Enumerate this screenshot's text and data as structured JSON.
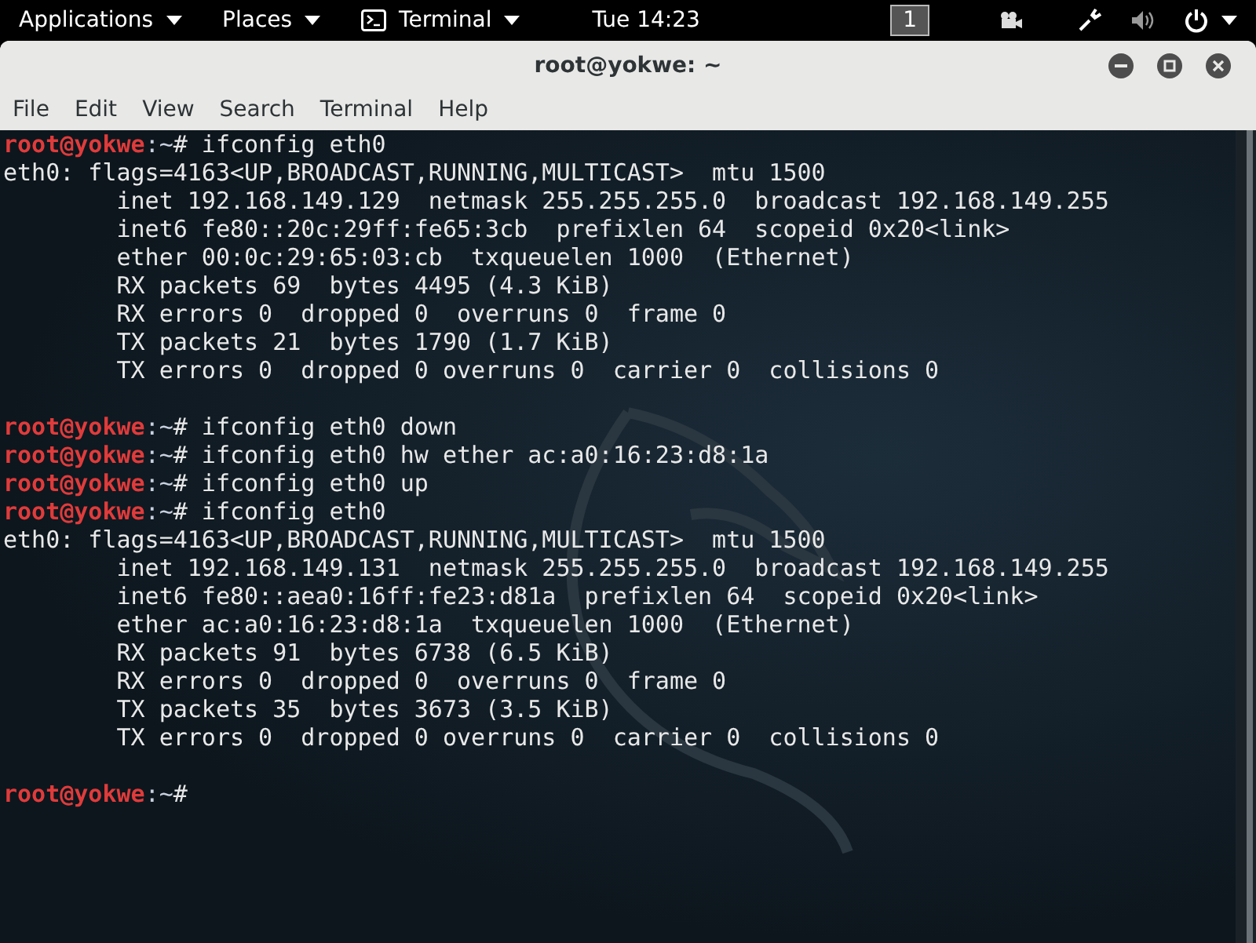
{
  "top_bar": {
    "menus": [
      {
        "label": "Applications",
        "kind": "menu"
      },
      {
        "label": "Places",
        "kind": "menu"
      },
      {
        "label": "Terminal",
        "kind": "app"
      }
    ],
    "clock": "Tue 14:23",
    "workspace": "1"
  },
  "window": {
    "title": "root@yokwe: ~"
  },
  "menu_bar": [
    "File",
    "Edit",
    "View",
    "Search",
    "Terminal",
    "Help"
  ],
  "terminal": {
    "lines": [
      {
        "kind": "prompt",
        "user": "root@yokwe",
        "path": ":~",
        "symbol": "#",
        "command": "ifconfig eth0"
      },
      {
        "kind": "output",
        "text": "eth0: flags=4163<UP,BROADCAST,RUNNING,MULTICAST>  mtu 1500"
      },
      {
        "kind": "output",
        "text": "        inet 192.168.149.129  netmask 255.255.255.0  broadcast 192.168.149.255"
      },
      {
        "kind": "output",
        "text": "        inet6 fe80::20c:29ff:fe65:3cb  prefixlen 64  scopeid 0x20<link>"
      },
      {
        "kind": "output",
        "text": "        ether 00:0c:29:65:03:cb  txqueuelen 1000  (Ethernet)"
      },
      {
        "kind": "output",
        "text": "        RX packets 69  bytes 4495 (4.3 KiB)"
      },
      {
        "kind": "output",
        "text": "        RX errors 0  dropped 0  overruns 0  frame 0"
      },
      {
        "kind": "output",
        "text": "        TX packets 21  bytes 1790 (1.7 KiB)"
      },
      {
        "kind": "output",
        "text": "        TX errors 0  dropped 0 overruns 0  carrier 0  collisions 0"
      },
      {
        "kind": "blank"
      },
      {
        "kind": "prompt",
        "user": "root@yokwe",
        "path": ":~",
        "symbol": "#",
        "command": "ifconfig eth0 down"
      },
      {
        "kind": "prompt",
        "user": "root@yokwe",
        "path": ":~",
        "symbol": "#",
        "command": "ifconfig eth0 hw ether ac:a0:16:23:d8:1a"
      },
      {
        "kind": "prompt",
        "user": "root@yokwe",
        "path": ":~",
        "symbol": "#",
        "command": "ifconfig eth0 up"
      },
      {
        "kind": "prompt",
        "user": "root@yokwe",
        "path": ":~",
        "symbol": "#",
        "command": "ifconfig eth0"
      },
      {
        "kind": "output",
        "text": "eth0: flags=4163<UP,BROADCAST,RUNNING,MULTICAST>  mtu 1500"
      },
      {
        "kind": "output",
        "text": "        inet 192.168.149.131  netmask 255.255.255.0  broadcast 192.168.149.255"
      },
      {
        "kind": "output",
        "text": "        inet6 fe80::aea0:16ff:fe23:d81a  prefixlen 64  scopeid 0x20<link>"
      },
      {
        "kind": "output",
        "text": "        ether ac:a0:16:23:d8:1a  txqueuelen 1000  (Ethernet)"
      },
      {
        "kind": "output",
        "text": "        RX packets 91  bytes 6738 (6.5 KiB)"
      },
      {
        "kind": "output",
        "text": "        RX errors 0  dropped 0  overruns 0  frame 0"
      },
      {
        "kind": "output",
        "text": "        TX packets 35  bytes 3673 (3.5 KiB)"
      },
      {
        "kind": "output",
        "text": "        TX errors 0  dropped 0 overruns 0  carrier 0  collisions 0"
      },
      {
        "kind": "blank"
      },
      {
        "kind": "prompt",
        "user": "root@yokwe",
        "path": ":~",
        "symbol": "#"
      }
    ]
  }
}
